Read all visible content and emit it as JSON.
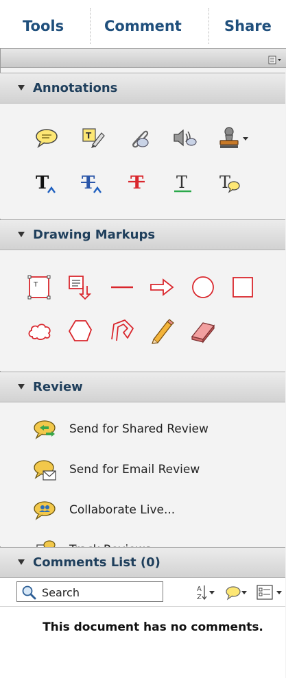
{
  "tabs": [
    {
      "label": "Tools"
    },
    {
      "label": "Comment"
    },
    {
      "label": "Share"
    }
  ],
  "sections": {
    "annotations": {
      "title": "Annotations"
    },
    "drawing": {
      "title": "Drawing Markups"
    },
    "review": {
      "title": "Review"
    },
    "comments": {
      "title": "Comments List (0)"
    }
  },
  "review_items": [
    {
      "label": "Send for Shared Review",
      "icon": "shared-review-icon"
    },
    {
      "label": "Send for Email Review",
      "icon": "email-review-icon"
    },
    {
      "label": "Collaborate Live...",
      "icon": "collaborate-live-icon"
    },
    {
      "label": "Track Reviews...",
      "icon": "track-reviews-icon"
    }
  ],
  "comments_list": {
    "search_placeholder": "Search",
    "empty_message": "This document has no comments."
  },
  "colors": {
    "tab_text": "#1f4f7c",
    "markup_red": "#d9262c",
    "section_text": "#1f3f5c"
  }
}
